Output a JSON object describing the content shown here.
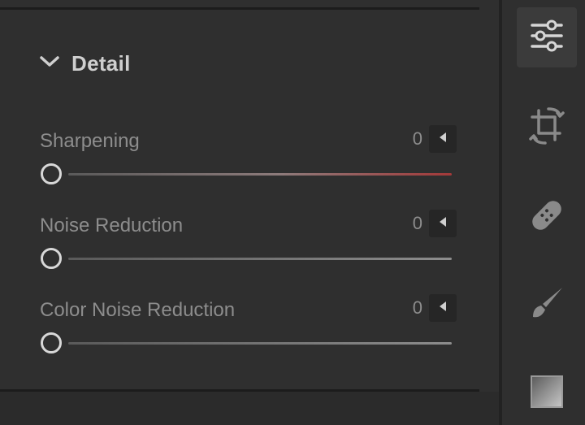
{
  "detail": {
    "title": "Detail",
    "sliders": [
      {
        "label": "Sharpening",
        "value": "0"
      },
      {
        "label": "Noise Reduction",
        "value": "0"
      },
      {
        "label": "Color Noise Reduction",
        "value": "0"
      }
    ]
  },
  "toolbar": {
    "tools": [
      {
        "icon": "adjustments-sliders-icon",
        "active": true
      },
      {
        "icon": "crop-icon",
        "active": false
      },
      {
        "icon": "healing-bandage-icon",
        "active": false
      },
      {
        "icon": "brush-icon",
        "active": false
      },
      {
        "icon": "gradient-square-icon",
        "active": false
      }
    ]
  },
  "colors": {
    "panel_bg": "#2f2f2f",
    "accent_red": "#a33939",
    "text_label": "#8d8d8d",
    "text_title": "#cfcfcf"
  }
}
